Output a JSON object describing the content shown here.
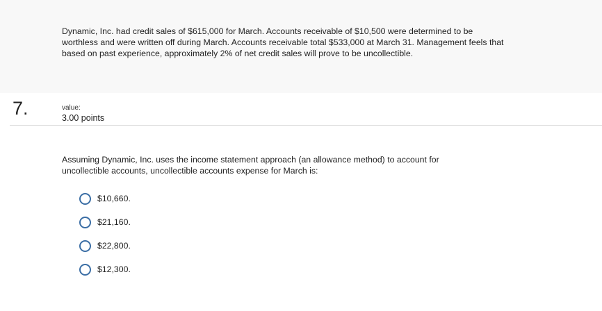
{
  "scenario": {
    "text": "Dynamic, Inc. had credit sales of $615,000 for March. Accounts receivable of $10,500 were determined to be worthless and were written off during March. Accounts receivable total $533,000 at March 31. Management feels that based on past experience, approximately 2% of net credit sales will prove to be uncollectible."
  },
  "question": {
    "number": "7.",
    "value_label": "value:",
    "points": "3.00 points",
    "prompt": "Assuming Dynamic, Inc. uses the income statement approach (an allowance method) to account for uncollectible accounts, uncollectible accounts expense for March is:",
    "options": [
      {
        "label": "$10,660."
      },
      {
        "label": "$21,160."
      },
      {
        "label": "$22,800."
      },
      {
        "label": "$12,300."
      }
    ]
  },
  "colors": {
    "scenario_background": "#f8f8f8",
    "radio_border": "#3b6ea5",
    "divider": "#dcdcdc"
  }
}
